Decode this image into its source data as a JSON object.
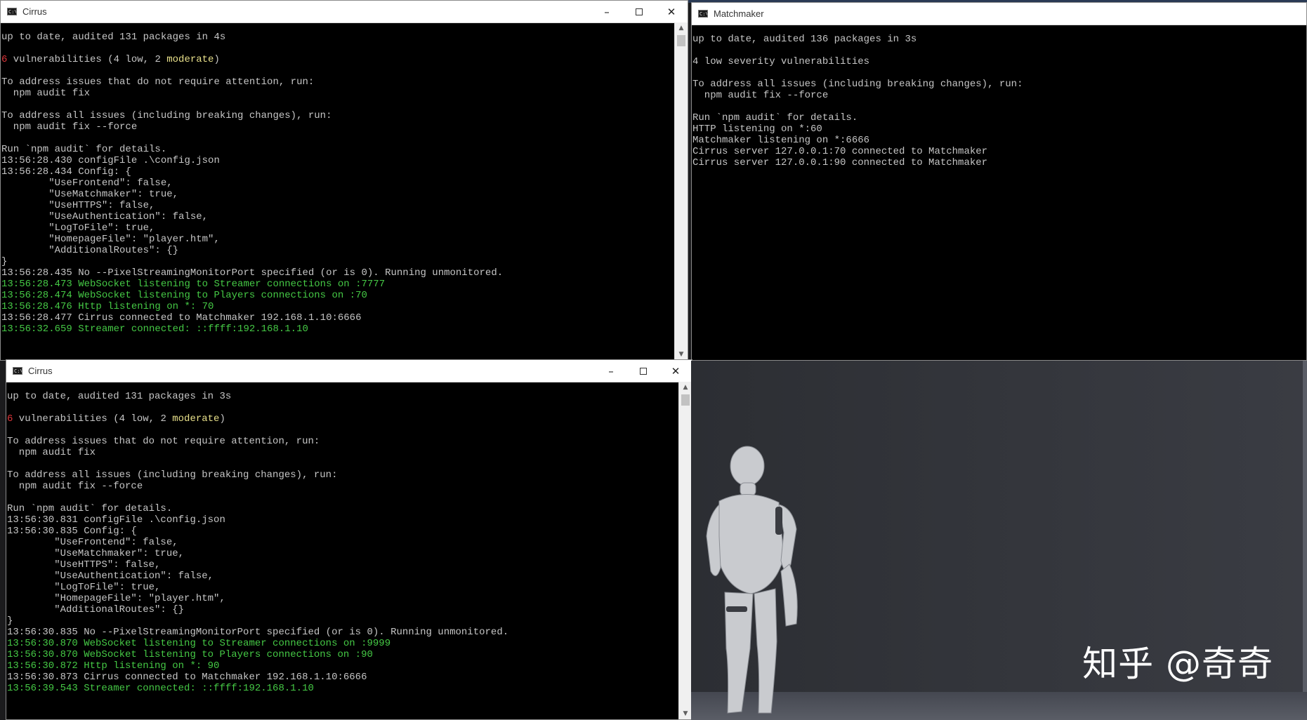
{
  "windows": {
    "cirrus_top": {
      "title": "Cirrus",
      "lines": [
        {
          "text": "up to date, audited 131 packages in 4s",
          "color": "default"
        },
        {
          "text": "",
          "color": "default"
        },
        {
          "segments": [
            {
              "text": "6",
              "color": "r"
            },
            {
              "text": " vulnerabilities (4 low, 2 ",
              "color": "default"
            },
            {
              "text": "moderate",
              "color": "y"
            },
            {
              "text": ")",
              "color": "default"
            }
          ]
        },
        {
          "text": "",
          "color": "default"
        },
        {
          "text": "To address issues that do not require attention, run:",
          "color": "default"
        },
        {
          "text": "  npm audit fix",
          "color": "default"
        },
        {
          "text": "",
          "color": "default"
        },
        {
          "text": "To address all issues (including breaking changes), run:",
          "color": "default"
        },
        {
          "text": "  npm audit fix --force",
          "color": "default"
        },
        {
          "text": "",
          "color": "default"
        },
        {
          "text": "Run `npm audit` for details.",
          "color": "default"
        },
        {
          "text": "13:56:28.430 configFile .\\config.json",
          "color": "default"
        },
        {
          "text": "13:56:28.434 Config: {",
          "color": "default"
        },
        {
          "text": "        \"UseFrontend\": false,",
          "color": "default"
        },
        {
          "text": "        \"UseMatchmaker\": true,",
          "color": "default"
        },
        {
          "text": "        \"UseHTTPS\": false,",
          "color": "default"
        },
        {
          "text": "        \"UseAuthentication\": false,",
          "color": "default"
        },
        {
          "text": "        \"LogToFile\": true,",
          "color": "default"
        },
        {
          "text": "        \"HomepageFile\": \"player.htm\",",
          "color": "default"
        },
        {
          "text": "        \"AdditionalRoutes\": {}",
          "color": "default"
        },
        {
          "text": "}",
          "color": "default"
        },
        {
          "text": "13:56:28.435 No --PixelStreamingMonitorPort specified (or is 0). Running unmonitored.",
          "color": "default"
        },
        {
          "text": "13:56:28.473 WebSocket listening to Streamer connections on :7777",
          "color": "g"
        },
        {
          "text": "13:56:28.474 WebSocket listening to Players connections on :70",
          "color": "g"
        },
        {
          "text": "13:56:28.476 Http listening on *: 70",
          "color": "g"
        },
        {
          "text": "13:56:28.477 Cirrus connected to Matchmaker 192.168.1.10:6666",
          "color": "default"
        },
        {
          "text": "13:56:32.659 Streamer connected: ::ffff:192.168.1.10",
          "color": "g"
        }
      ]
    },
    "matchmaker": {
      "title": "Matchmaker",
      "lines": [
        {
          "text": "up to date, audited 136 packages in 3s",
          "color": "default"
        },
        {
          "text": "",
          "color": "default"
        },
        {
          "text": "4 low severity vulnerabilities",
          "color": "default"
        },
        {
          "text": "",
          "color": "default"
        },
        {
          "text": "To address all issues (including breaking changes), run:",
          "color": "default"
        },
        {
          "text": "  npm audit fix --force",
          "color": "default"
        },
        {
          "text": "",
          "color": "default"
        },
        {
          "text": "Run `npm audit` for details.",
          "color": "default"
        },
        {
          "text": "HTTP listening on *:60",
          "color": "default"
        },
        {
          "text": "Matchmaker listening on *:6666",
          "color": "default"
        },
        {
          "text": "Cirrus server 127.0.0.1:70 connected to Matchmaker",
          "color": "default"
        },
        {
          "text": "Cirrus server 127.0.0.1:90 connected to Matchmaker",
          "color": "default"
        }
      ]
    },
    "cirrus_bottom": {
      "title": "Cirrus",
      "lines": [
        {
          "text": "up to date, audited 131 packages in 3s",
          "color": "default"
        },
        {
          "text": "",
          "color": "default"
        },
        {
          "segments": [
            {
              "text": "6",
              "color": "r"
            },
            {
              "text": " vulnerabilities (4 low, 2 ",
              "color": "default"
            },
            {
              "text": "moderate",
              "color": "y"
            },
            {
              "text": ")",
              "color": "default"
            }
          ]
        },
        {
          "text": "",
          "color": "default"
        },
        {
          "text": "To address issues that do not require attention, run:",
          "color": "default"
        },
        {
          "text": "  npm audit fix",
          "color": "default"
        },
        {
          "text": "",
          "color": "default"
        },
        {
          "text": "To address all issues (including breaking changes), run:",
          "color": "default"
        },
        {
          "text": "  npm audit fix --force",
          "color": "default"
        },
        {
          "text": "",
          "color": "default"
        },
        {
          "text": "Run `npm audit` for details.",
          "color": "default"
        },
        {
          "text": "13:56:30.831 configFile .\\config.json",
          "color": "default"
        },
        {
          "text": "13:56:30.835 Config: {",
          "color": "default"
        },
        {
          "text": "        \"UseFrontend\": false,",
          "color": "default"
        },
        {
          "text": "        \"UseMatchmaker\": true,",
          "color": "default"
        },
        {
          "text": "        \"UseHTTPS\": false,",
          "color": "default"
        },
        {
          "text": "        \"UseAuthentication\": false,",
          "color": "default"
        },
        {
          "text": "        \"LogToFile\": true,",
          "color": "default"
        },
        {
          "text": "        \"HomepageFile\": \"player.htm\",",
          "color": "default"
        },
        {
          "text": "        \"AdditionalRoutes\": {}",
          "color": "default"
        },
        {
          "text": "}",
          "color": "default"
        },
        {
          "text": "13:56:30.835 No --PixelStreamingMonitorPort specified (or is 0). Running unmonitored.",
          "color": "default"
        },
        {
          "text": "13:56:30.870 WebSocket listening to Streamer connections on :9999",
          "color": "g"
        },
        {
          "text": "13:56:30.870 WebSocket listening to Players connections on :90",
          "color": "g"
        },
        {
          "text": "13:56:30.872 Http listening on *: 90",
          "color": "g"
        },
        {
          "text": "13:56:30.873 Cirrus connected to Matchmaker 192.168.1.10:6666",
          "color": "default"
        },
        {
          "text": "13:56:39.543 Streamer connected: ::ffff:192.168.1.10",
          "color": "g"
        }
      ]
    }
  },
  "controls": {
    "minimize": "–",
    "maximize": "",
    "close": "✕"
  },
  "icons": {
    "console": "cmd-icon",
    "scroll_up": "▲",
    "scroll_down": "▼"
  },
  "viewport": {
    "watermark": "知乎 @奇奇"
  },
  "colors": {
    "console_text": "#c6c6c6",
    "green": "#45c945",
    "yellow": "#e8e08a",
    "red": "#e0363b"
  }
}
